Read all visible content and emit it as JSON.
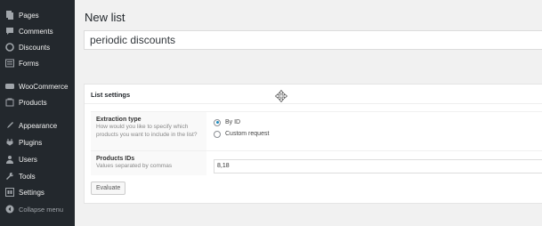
{
  "sidebar": {
    "items": [
      {
        "label": "Pages",
        "icon": "pages-icon"
      },
      {
        "label": "Comments",
        "icon": "comments-icon"
      },
      {
        "label": "Discounts",
        "icon": "discounts-icon"
      },
      {
        "label": "Forms",
        "icon": "forms-icon"
      },
      {
        "label": "WooCommerce",
        "icon": "woocommerce-icon"
      },
      {
        "label": "Products",
        "icon": "products-icon"
      },
      {
        "label": "Appearance",
        "icon": "appearance-icon"
      },
      {
        "label": "Plugins",
        "icon": "plugins-icon"
      },
      {
        "label": "Users",
        "icon": "users-icon"
      },
      {
        "label": "Tools",
        "icon": "tools-icon"
      },
      {
        "label": "Settings",
        "icon": "settings-icon"
      },
      {
        "label": "Collapse menu",
        "icon": "collapse-icon"
      }
    ]
  },
  "main": {
    "title": "New list",
    "list_name_value": "periodic discounts",
    "settings_box": {
      "heading": "List settings",
      "extraction": {
        "label": "Extraction type",
        "description": "How would you like to specify which products you want to include in the list?",
        "options": [
          "By ID",
          "Custom request"
        ],
        "selected": "By ID"
      },
      "products": {
        "label": "Products IDs",
        "description": "Values separated by commas",
        "value": "8,18"
      },
      "evaluate_label": "Evaluate"
    }
  }
}
